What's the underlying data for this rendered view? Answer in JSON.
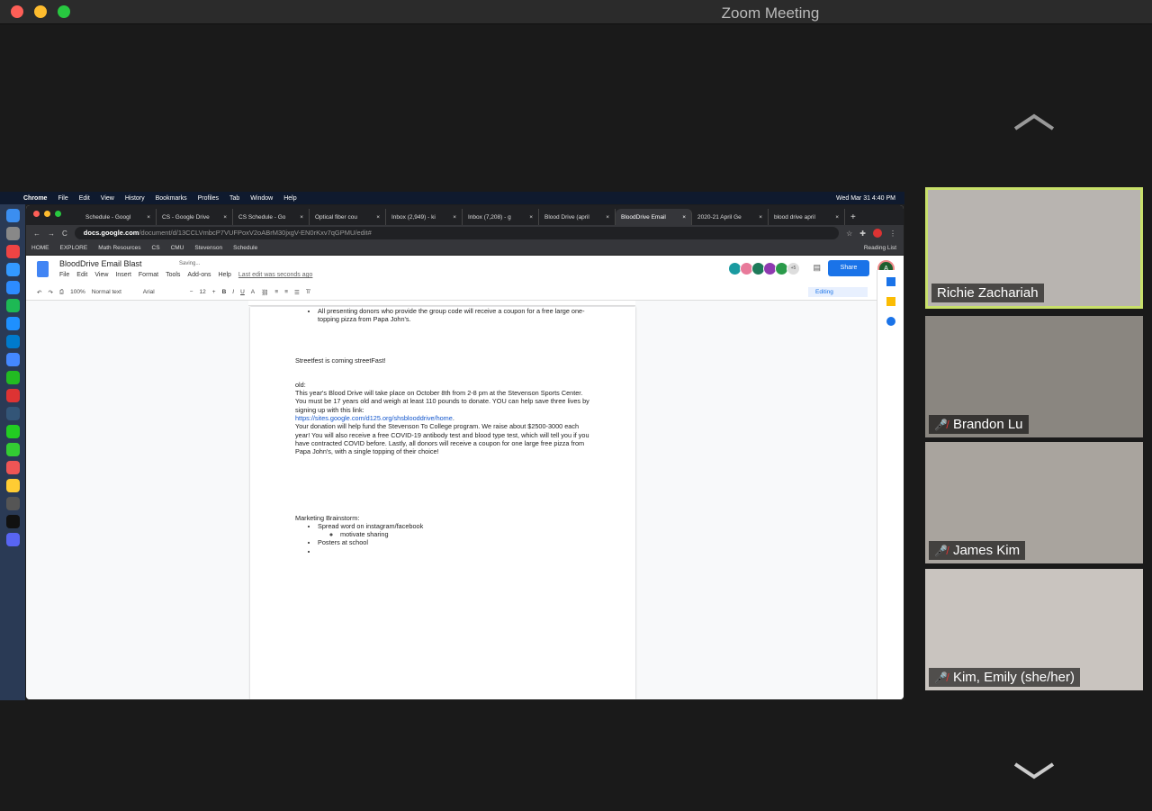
{
  "window": {
    "title": "Zoom Meeting"
  },
  "mac_menubar": {
    "items": [
      "Chrome",
      "File",
      "Edit",
      "View",
      "History",
      "Bookmarks",
      "Profiles",
      "Tab",
      "Window",
      "Help"
    ],
    "clock": "Wed Mar 31  4:40 PM"
  },
  "tabs": [
    {
      "label": "Schedule - Googl"
    },
    {
      "label": "CS - Google Drive"
    },
    {
      "label": "CS Schedule - Go"
    },
    {
      "label": "Optical fiber cou"
    },
    {
      "label": "Inbox (2,949) - ki"
    },
    {
      "label": "Inbox (7,208) - g"
    },
    {
      "label": "Blood Drive (april"
    },
    {
      "label": "BloodDrive Email"
    },
    {
      "label": "2020-21 April Ge"
    },
    {
      "label": "blood drive april"
    }
  ],
  "address": {
    "host": "docs.google.com",
    "path": "/document/d/13CCLVmbcP7VUFPoxV2oABrM30jxgV-EN0rKxv7qGPMU/edit#"
  },
  "bookmarks": [
    "HOME",
    "EXPLORE",
    "Math Resources",
    "CS",
    "CMU",
    "Stevenson",
    "Schedule"
  ],
  "reading_list": "Reading List",
  "doc": {
    "title": "BloodDrive Email Blast",
    "saving": "Saving...",
    "menu": [
      "File",
      "Edit",
      "View",
      "Insert",
      "Format",
      "Tools",
      "Add-ons",
      "Help"
    ],
    "last_edit": "Last edit was seconds ago",
    "share": "Share",
    "avatar": "A",
    "collab_more": "+5",
    "toolbar": {
      "zoom": "100%",
      "style": "Normal text",
      "font": "Arial",
      "size": "12",
      "mode": "Editing"
    },
    "body": {
      "bullet_top": "All presenting donors who provide the group code will receive a coupon for a free large one-topping pizza from Papa John's.",
      "streetfest": "Streetfest is coming streetFast!",
      "old_label": "old:",
      "para1": "This year's Blood Drive will take place on October 8th from 2-8 pm at the Stevenson Sports Center. You must be 17 years old and weigh at least 110 pounds to donate. YOU can help save three lives by signing up with this link:",
      "link": "https://sites.google.com/d125.org/shsblooddrive/home",
      "para2": "Your donation will help fund the Stevenson To College program. We raise about $2500-3000 each year! You will also receive a free COVID-19 antibody test and blood type test, which will tell you if you have contracted COVID before. Lastly, all donors will receive a coupon for one large free pizza from Papa John's, with a single topping of their choice!",
      "marketing": "Marketing Brainstorm:",
      "items": [
        "Spread word on instagram/facebook",
        "Posters at school",
        ""
      ],
      "subitem": "motivate sharing"
    }
  },
  "participants": [
    {
      "name": "Richie Zachariah",
      "muted": false
    },
    {
      "name": "Brandon Lu",
      "muted": true
    },
    {
      "name": "James Kim",
      "muted": true
    },
    {
      "name": "Kim, Emily (she/her)",
      "muted": true
    }
  ]
}
